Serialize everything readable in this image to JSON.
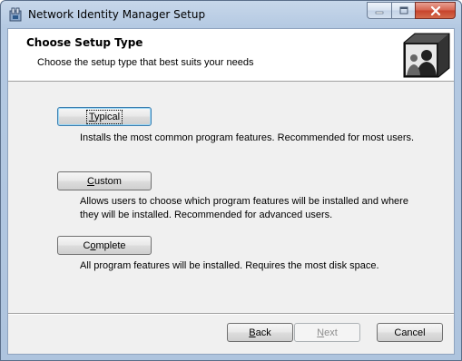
{
  "window": {
    "title": "Network Identity Manager Setup",
    "accent_color": "#b4c9e2",
    "close_color": "#c7422b"
  },
  "banner": {
    "title": "Choose Setup Type",
    "subtitle": "Choose the setup type that best suits your needs"
  },
  "options": [
    {
      "label_pre": "",
      "label_ul": "T",
      "label_post": "ypical",
      "description": "Installs the most common program features. Recommended for most users."
    },
    {
      "label_pre": "",
      "label_ul": "C",
      "label_post": "ustom",
      "description_line1": "Allows users to choose which program features will be installed and where",
      "description_line2": "they will be installed. Recommended for advanced users."
    },
    {
      "label_pre": "C",
      "label_ul": "o",
      "label_post": "mplete",
      "description": "All program features will be installed. Requires the most disk space."
    }
  ],
  "footer": {
    "back": {
      "label_ul": "B",
      "label_post": "ack"
    },
    "next": {
      "label_ul": "N",
      "label_post": "ext",
      "disabled": true
    },
    "cancel": {
      "label": "Cancel"
    }
  }
}
